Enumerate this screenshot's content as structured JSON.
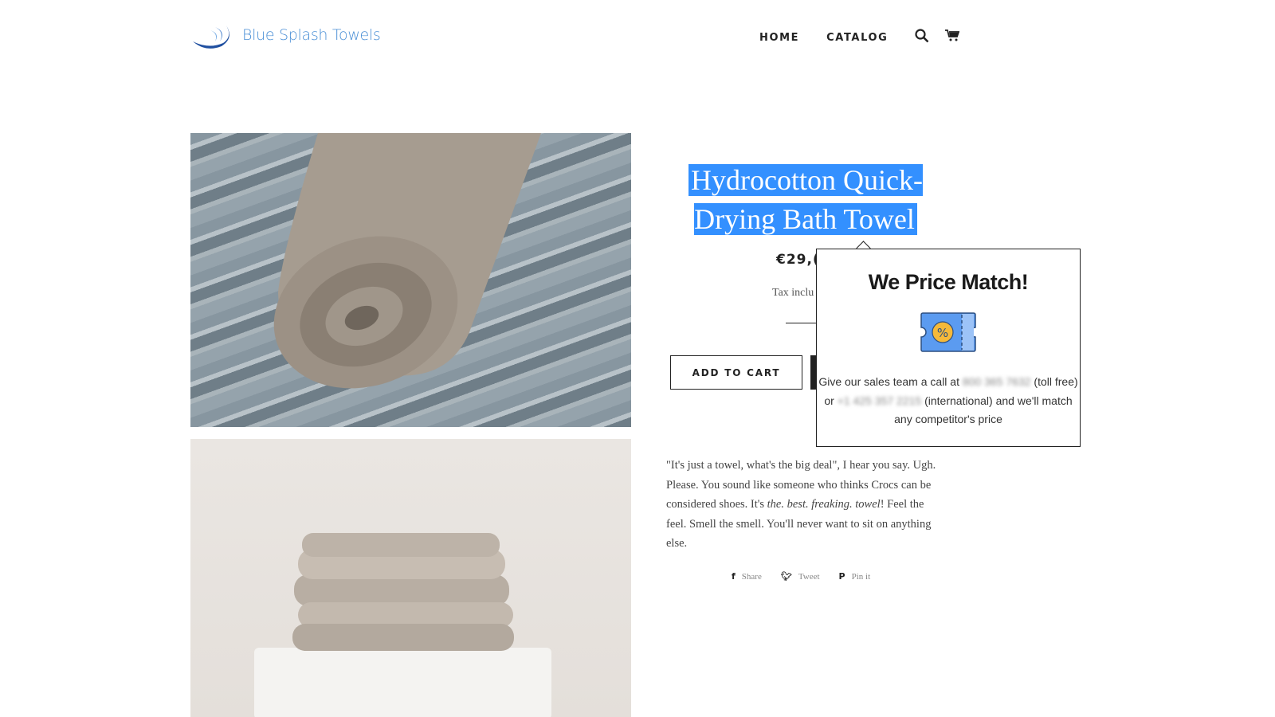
{
  "header": {
    "logo_text": "Blue Splash Towels",
    "nav": [
      {
        "label": "HOME"
      },
      {
        "label": "CATALOG"
      }
    ],
    "icons": [
      "search-icon",
      "cart-icon"
    ]
  },
  "product": {
    "title": "Hydrocotton Quick-Drying Bath Towel",
    "price": "€29,(",
    "tax_note": "Tax inclu",
    "add_to_cart": "ADD TO CART",
    "description": {
      "line1": "\"It's just a towel, what's the big deal\", I hear you say. Ugh. Please. You sound like someone who thinks Crocs can be considered shoes. It's ",
      "emphasis": "the. best. freaking. towel",
      "line2": "! Feel the feel. Smell the smell. You'll never want to sit on anything else."
    },
    "share": [
      {
        "label": "Share",
        "icon": "facebook-icon"
      },
      {
        "label": "Tweet",
        "icon": "twitter-icon"
      },
      {
        "label": "Pin it",
        "icon": "pinterest-icon"
      }
    ]
  },
  "popup": {
    "title": "We Price Match!",
    "icon": "discount-ticket-icon",
    "text_a": "Give our sales team a call at ",
    "phone_tollfree": "800 365 7632",
    "text_b": " (toll free) or ",
    "phone_intl": "+1 425 357 2215",
    "text_c": " (international) and we'll match any competitor's price"
  },
  "colors": {
    "selection": "#3390ff",
    "logo": "#4a8fd6",
    "ticket": "#5b9bf0",
    "badge": "#f5b93a"
  }
}
